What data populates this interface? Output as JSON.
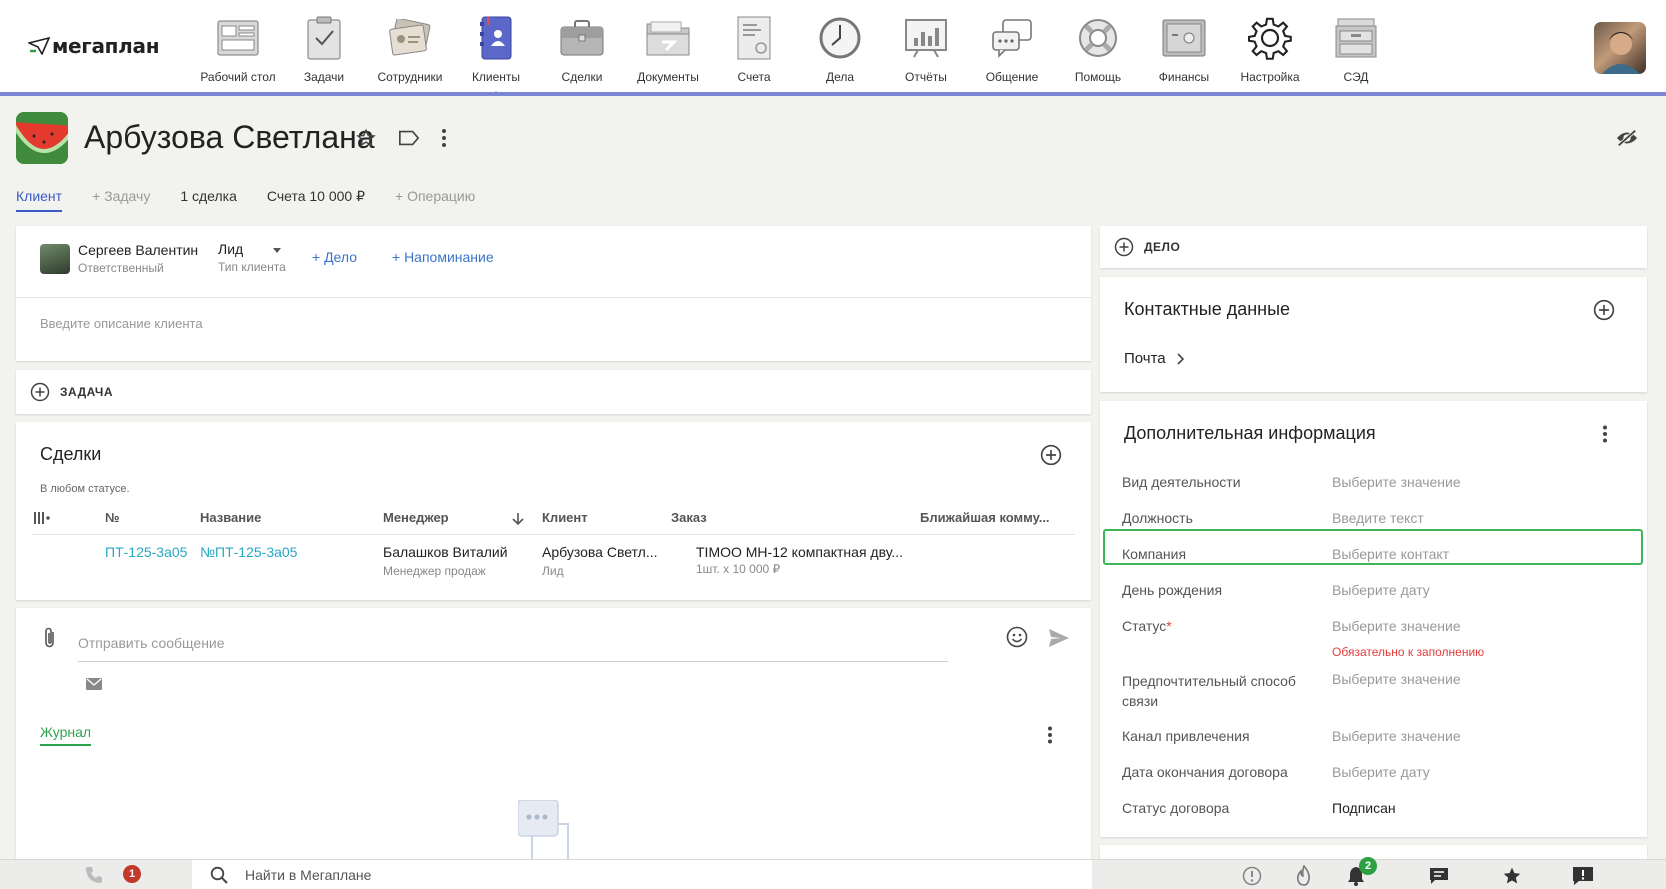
{
  "app": {
    "logo_text": "мегаплан"
  },
  "nav": [
    {
      "label": "Рабочий стол",
      "icon": "desktop-icon",
      "active": false
    },
    {
      "label": "Задачи",
      "icon": "tasks-clipboard-icon",
      "active": false
    },
    {
      "label": "Сотрудники",
      "icon": "employees-cards-icon",
      "active": false
    },
    {
      "label": "Клиенты",
      "icon": "clients-address-book-icon",
      "active": true
    },
    {
      "label": "Сделки",
      "icon": "deals-briefcase-icon",
      "active": false
    },
    {
      "label": "Документы",
      "icon": "documents-folder-icon",
      "active": false
    },
    {
      "label": "Счета",
      "icon": "invoices-sheet-icon",
      "active": false
    },
    {
      "label": "Дела",
      "icon": "clock-icon",
      "active": false
    },
    {
      "label": "Отчёты",
      "icon": "reports-board-icon",
      "active": false
    },
    {
      "label": "Общение",
      "icon": "chat-bubbles-icon",
      "active": false
    },
    {
      "label": "Помощь",
      "icon": "lifebuoy-icon",
      "active": false
    },
    {
      "label": "Финансы",
      "icon": "safe-icon",
      "active": false
    },
    {
      "label": "Настройка",
      "icon": "gear-icon",
      "active": false
    },
    {
      "label": "СЭД",
      "icon": "archive-cabinet-icon",
      "active": false
    }
  ],
  "client": {
    "name": "Арбузова Светлана",
    "tabs": [
      "Клиент",
      "+ Задачу",
      "1 сделка",
      "Счета 10 000 ₽",
      "+ Операцию"
    ]
  },
  "summary": {
    "responsible_name": "Сергеев Валентин",
    "responsible_label": "Ответственный",
    "client_type": "Лид",
    "client_type_label": "Тип клиента",
    "add_case": "+ Дело",
    "add_reminder": "+ Напоминание",
    "description_placeholder": "Введите описание клиента"
  },
  "task_block": {
    "label": "ЗАДАЧА"
  },
  "deals": {
    "title": "Сделки",
    "filter": "В любом статусе.",
    "columns": [
      "№",
      "Название",
      "Менеджер",
      "Клиент",
      "Заказ",
      "Ближайшая комму..."
    ],
    "rows": [
      {
        "number": "ПТ-125-3а05",
        "name": "№ПТ-125-3а05",
        "manager": "Балашков Виталий",
        "manager_role": "Менеджер продаж",
        "client": "Арбузова Светл...",
        "client_type": "Лид",
        "order": "TIMOO MH-12 компактная дву...",
        "order_detail": "1шт. x 10 000 ₽",
        "next_comm": ""
      }
    ]
  },
  "message": {
    "placeholder": "Отправить сообщение",
    "journal_tab": "Журнал"
  },
  "right": {
    "case_label": "ДЕЛО",
    "contacts_title": "Контактные данные",
    "contacts_mail": "Почта",
    "extra_title": "Дополнительная информация",
    "fields": [
      {
        "label": "Вид деятельности",
        "value": "Выберите значение",
        "required": false,
        "filled": false
      },
      {
        "label": "Должность",
        "value": "Введите текст",
        "required": false,
        "filled": false
      },
      {
        "label": "Компания",
        "value": "Выберите контакт",
        "required": false,
        "filled": false,
        "highlighted": true
      },
      {
        "label": "День рождения",
        "value": "Выберите дату",
        "required": false,
        "filled": false
      },
      {
        "label": "Статус",
        "value": "Выберите значение",
        "required": true,
        "filled": false,
        "note": "Обязательно к заполнению"
      },
      {
        "label": "Предпочтительный способ связи",
        "value": "Выберите значение",
        "required": false,
        "filled": false
      },
      {
        "label": "Канал привлечения",
        "value": "Выберите значение",
        "required": false,
        "filled": false
      },
      {
        "label": "Дата окончания договора",
        "value": "Выберите дату",
        "required": false,
        "filled": false
      },
      {
        "label": "Статус договора",
        "value": "Подписан",
        "required": false,
        "filled": true
      }
    ],
    "required_mark": "*"
  },
  "bottom": {
    "search_placeholder": "Найти в Мегаплане",
    "calls_badge": "1",
    "notifications_badge": "2",
    "colors": {
      "calls_badge": "#c0392b",
      "notif_badge": "#2ea043"
    }
  },
  "colors": {
    "accent": "#7b86d6",
    "link": "#3b73c9",
    "teal": "#26a8c4",
    "green": "#2da44e",
    "required": "#e23b3b"
  }
}
